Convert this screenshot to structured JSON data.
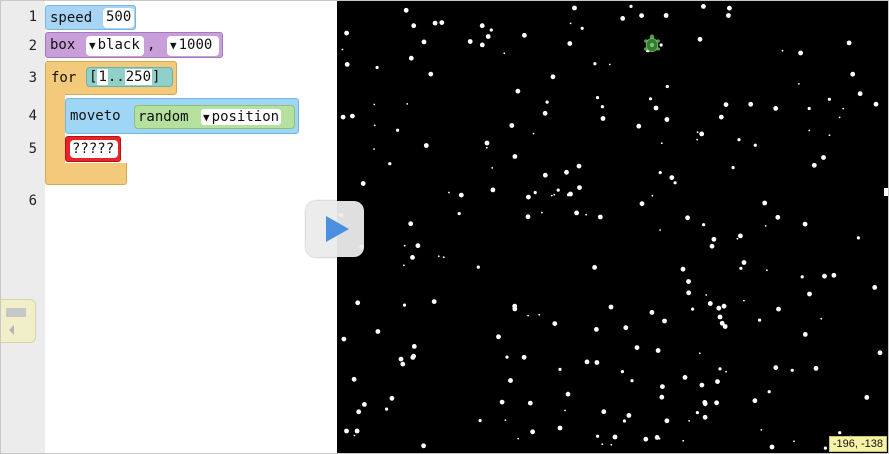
{
  "editor": {
    "line_numbers": [
      "1",
      "2",
      "3",
      "4",
      "5",
      "6"
    ],
    "blocks": {
      "speed": {
        "keyword": "speed",
        "value": "500"
      },
      "box": {
        "keyword": "box",
        "color": "black",
        "comma": ",",
        "size": "1000"
      },
      "for_loop": {
        "keyword": "for",
        "range_open": "[",
        "range_start": "1",
        "range_sep": "..",
        "range_end": "250",
        "range_close": "]"
      },
      "moveto": {
        "keyword": "moveto",
        "arg_keyword": "random",
        "arg_value": "position"
      },
      "placeholder": {
        "text": "?????"
      }
    },
    "dropdown_glyph": "▼"
  },
  "stage": {
    "coord_readout": "-196, -138",
    "background": "#000000"
  },
  "colors": {
    "speed_block": "#a8d4f5",
    "box_block": "#c99fd9",
    "for_block": "#f3c97c",
    "moveto_block": "#9fd5f5",
    "range_block": "#91d0c8",
    "random_block": "#b5e09d",
    "error_block": "#e8232a",
    "gutter": "#ececec"
  },
  "icons": {
    "run": "play-triangle-icon",
    "palette": "block-palette-icon",
    "turtle": "turtle-icon"
  }
}
